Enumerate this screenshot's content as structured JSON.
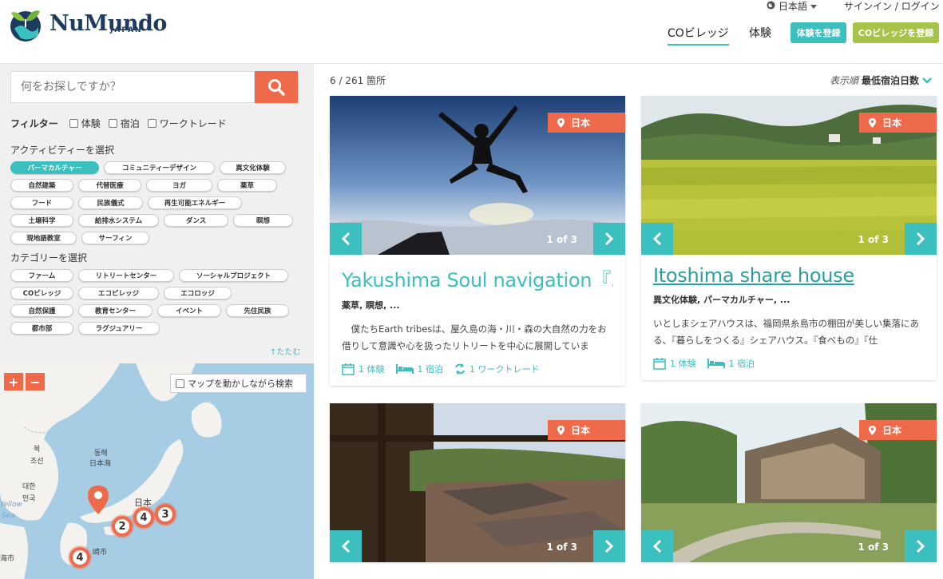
{
  "brand": {
    "name": "NuMundo",
    "sub": "JAPAN"
  },
  "header": {
    "language": "日本語",
    "auth": "サインイン / ログイン",
    "nav_co": "COビレッジ",
    "nav_exp": "体験",
    "register_exp": "体験を登録",
    "register_co": "COビレッジを登録"
  },
  "search": {
    "placeholder": "何をお探しですか？"
  },
  "filter": {
    "label": "フィルター",
    "options": [
      "体験",
      "宿泊",
      "ワークトレード"
    ]
  },
  "activities": {
    "label": "アクティビティーを選択",
    "tags": [
      "パーマカルチャー",
      "コミュニティーデザイン",
      "異文化体験",
      "自然建築",
      "代替医療",
      "ヨガ",
      "薬草",
      "フード",
      "民族儀式",
      "再生可能エネルギー",
      "土壌科学",
      "給排水システム",
      "ダンス",
      "瞑想",
      "現地語教室",
      "サーフィン"
    ]
  },
  "categories": {
    "label": "カテゴリーを選択",
    "tags": [
      "ファーム",
      "リトリートセンター",
      "ソーシャルプロジェクト",
      "COビレッジ",
      "エコビレッジ",
      "エコロッジ",
      "自然保護",
      "教育センター",
      "イベント",
      "先住民族",
      "都市部",
      "ラグジュアリー"
    ]
  },
  "collapse": "↑たたむ",
  "map": {
    "zoom_in": "+",
    "zoom_out": "−",
    "search_on_move": "マップを動かしながら検索",
    "labels": [
      "동해",
      "日本海",
      "북",
      "조선",
      "대한",
      "민국",
      "日本",
      "崎市",
      "Yellow",
      "Sea",
      "海市"
    ],
    "clusters": [
      "2",
      "4",
      "3",
      "4"
    ]
  },
  "results": {
    "count": "6 / 261 箇所",
    "sort_label": "表示順",
    "sort_value": "最低宿泊日数"
  },
  "cards": [
    {
      "location": "日本",
      "counter": "1 of 3",
      "title": "Yakushima Soul navigation『...",
      "cats": "薬草, 瞑想, ...",
      "desc": "　僕たちEarth tribesは、屋久島の海・川・森の大自然の力をお借りして意識や心を扱ったリトリートを中心に展開していま",
      "meta": [
        "1 体験",
        "1 宿泊",
        "1 ワークトレード"
      ]
    },
    {
      "location": "日本",
      "counter": "1 of 3",
      "title": "Itoshima share house",
      "cats": "異文化体験, パーマカルチャー, ...",
      "desc": "いとしまシェアハウスは、福岡県糸島市の棚田が美しい集落にある、『暮らしをつくる』シェアハウス。『食べもの』『仕",
      "meta": [
        "1 体験",
        "1 宿泊"
      ]
    },
    {
      "location": "日本",
      "counter": "1 of 3"
    },
    {
      "location": "日本",
      "counter": "1 of 3"
    }
  ]
}
